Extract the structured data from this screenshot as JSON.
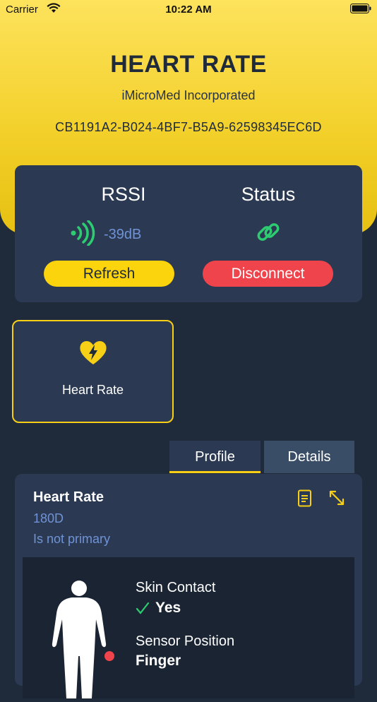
{
  "status_bar": {
    "carrier": "Carrier",
    "time": "10:22 AM"
  },
  "device": {
    "name": "HEART RATE",
    "manufacturer": "iMicroMed Incorporated",
    "uuid": "CB1191A2-B024-4BF7-B5A9-62598345EC6D"
  },
  "connection": {
    "rssi_label": "RSSI",
    "rssi_value": "-39dB",
    "status_label": "Status",
    "refresh_label": "Refresh",
    "disconnect_label": "Disconnect"
  },
  "services": [
    {
      "label": "Heart Rate",
      "icon": "heart-bolt-icon"
    }
  ],
  "tabs": {
    "profile": "Profile",
    "details": "Details",
    "active": "Profile"
  },
  "characteristic": {
    "title": "Heart Rate",
    "uuid": "180D",
    "primary": "Is not primary",
    "skin_contact_label": "Skin Contact",
    "skin_contact_value": "Yes",
    "sensor_position_label": "Sensor Position",
    "sensor_position_value": "Finger"
  },
  "colors": {
    "accent": "#f7cf16",
    "danger": "#f0444c",
    "panel": "#2b3a52",
    "bg": "#1f2a3a",
    "signal": "#2ecc71",
    "muted_blue": "#6f93d6"
  }
}
